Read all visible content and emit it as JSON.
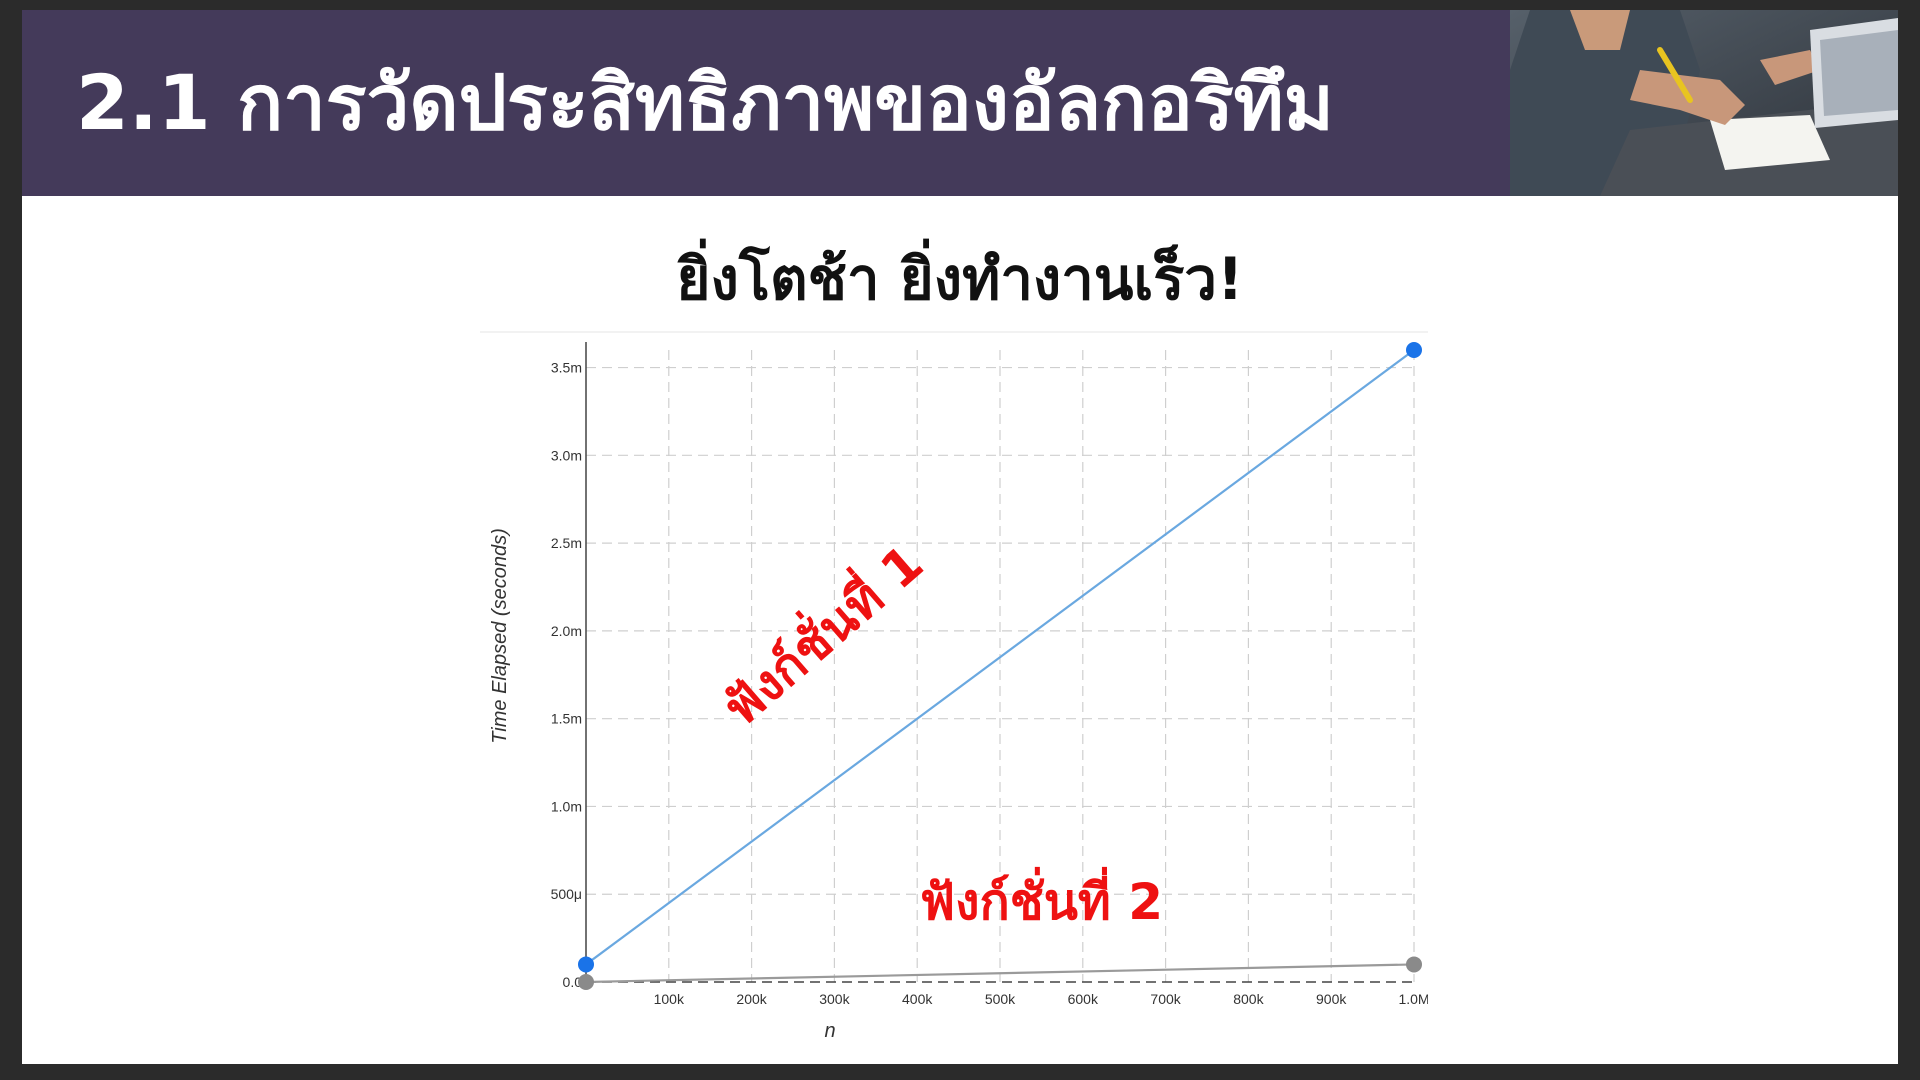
{
  "slide": {
    "title": "2.1 การวัดประสิทธิภาพของอัลกอริทึม",
    "subtitle": "ยิ่งโตช้า ยิ่งทำงานเร็ว!",
    "header_bg": "#443a5a",
    "photo_icon": "person-writing-at-desk-photo"
  },
  "chart_data": {
    "type": "line",
    "xlabel": "n",
    "ylabel": "Time Elapsed (seconds)",
    "xlim": [
      0,
      1000000
    ],
    "ylim": [
      0,
      0.0036
    ],
    "grid": true,
    "x_ticks": [
      {
        "value": 100000,
        "label": "100k"
      },
      {
        "value": 200000,
        "label": "200k"
      },
      {
        "value": 300000,
        "label": "300k"
      },
      {
        "value": 400000,
        "label": "400k"
      },
      {
        "value": 500000,
        "label": "500k"
      },
      {
        "value": 600000,
        "label": "600k"
      },
      {
        "value": 700000,
        "label": "700k"
      },
      {
        "value": 800000,
        "label": "800k"
      },
      {
        "value": 900000,
        "label": "900k"
      },
      {
        "value": 1000000,
        "label": "1.0M"
      }
    ],
    "y_ticks": [
      {
        "value": 0,
        "label": "0.0"
      },
      {
        "value": 0.0005,
        "label": "500μ"
      },
      {
        "value": 0.001,
        "label": "1.0m"
      },
      {
        "value": 0.0015,
        "label": "1.5m"
      },
      {
        "value": 0.002,
        "label": "2.0m"
      },
      {
        "value": 0.0025,
        "label": "2.5m"
      },
      {
        "value": 0.003,
        "label": "3.0m"
      },
      {
        "value": 0.0035,
        "label": "3.5m"
      }
    ],
    "series": [
      {
        "color": "#6aa8e0",
        "marker_color": "#1a73e8",
        "x": [
          0,
          1000000
        ],
        "y": [
          0.0001,
          0.0036
        ]
      },
      {
        "color": "#9a9a9a",
        "marker_color": "#8a8a8a",
        "x": [
          0,
          1000000
        ],
        "y": [
          0.0,
          0.0001
        ]
      }
    ],
    "annotations": [
      {
        "text": "ฟังก์ชั่นที่ 1",
        "color": "#ee1111",
        "x": 300000,
        "y": 0.0019,
        "rotate": -41,
        "size": 50
      },
      {
        "text": "ฟังก์ชั่นที่ 2",
        "color": "#ee1111",
        "x": 550000,
        "y": 0.00036,
        "rotate": 0,
        "size": 50
      }
    ]
  }
}
